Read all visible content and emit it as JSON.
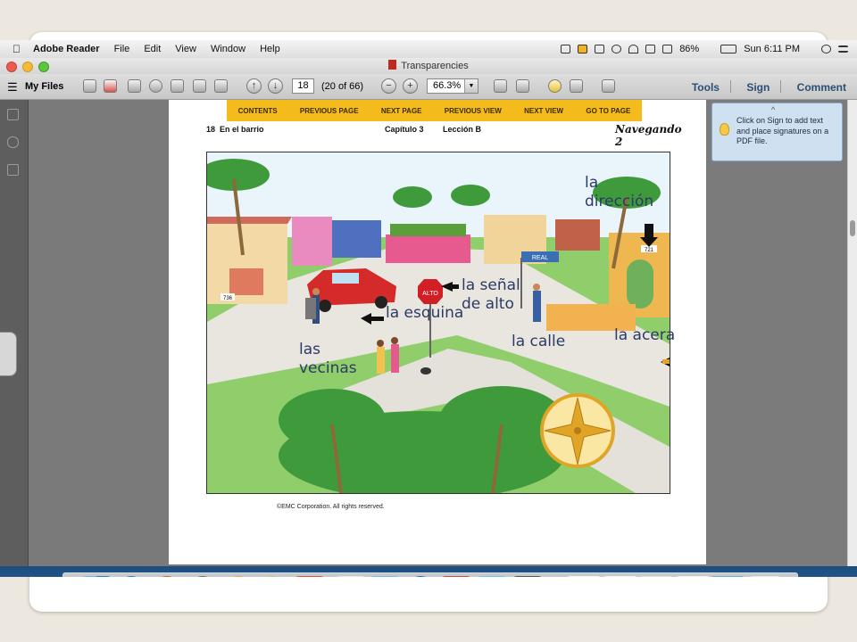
{
  "menubar": {
    "app_name": "Adobe Reader",
    "items": [
      "File",
      "Edit",
      "View",
      "Window",
      "Help"
    ],
    "battery": "86%",
    "clock": "Sun 6:11 PM"
  },
  "window": {
    "title": "Transparencies"
  },
  "toolbar": {
    "my_files": "My Files",
    "page_number": "18",
    "page_count": "(20 of 66)",
    "zoom": "66.3%",
    "tools": "Tools",
    "sign": "Sign",
    "comment": "Comment"
  },
  "document": {
    "nav": [
      "CONTENTS",
      "PREVIOUS PAGE",
      "NEXT PAGE",
      "PREVIOUS VIEW",
      "NEXT VIEW",
      "GO TO PAGE"
    ],
    "page_num": "18",
    "page_title": "En el barrio",
    "chapter": "Capítulo 3",
    "lesson": "Lección B",
    "brand": "Navegando 2",
    "copyright": "©EMC Corporation. All rights reserved.",
    "sign_stop": "ALTO",
    "sign_street": "REAL",
    "house_num_a": "721",
    "house_num_b": "736"
  },
  "annotations": {
    "direccion": "la dirección",
    "senal": "la señal de alto",
    "esquina": "la esquina",
    "acera": "la acera",
    "calle": "la calle",
    "vecinas": "las vecinas"
  },
  "right_panel": {
    "tip": "Click on Sign to add text and place signatures on a PDF file."
  }
}
